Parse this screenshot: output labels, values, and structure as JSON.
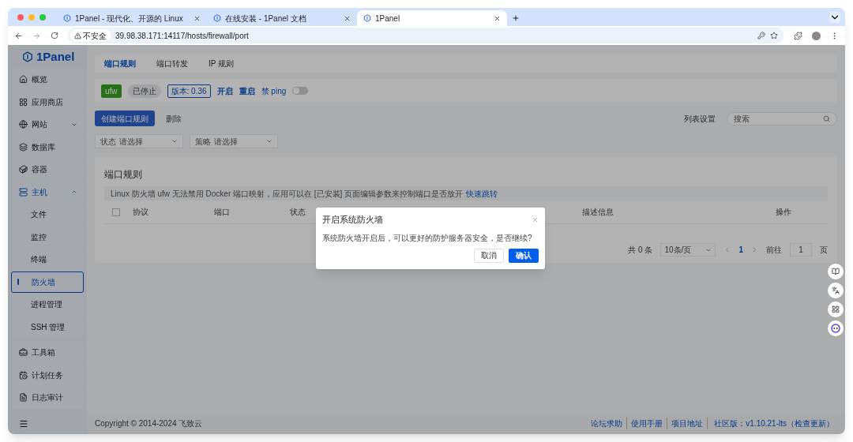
{
  "browser": {
    "tabs": [
      {
        "title": "1Panel - 现代化、开源的 Linux",
        "selected": false
      },
      {
        "title": "在线安装 - 1Panel 文档",
        "selected": false
      },
      {
        "title": "1Panel",
        "selected": true
      }
    ],
    "security": "不安全",
    "url": "39.98.38.171:14117/hosts/firewall/port"
  },
  "sidebar": {
    "logo": "1Panel",
    "items": [
      {
        "label": "概览",
        "selected": false
      },
      {
        "label": "应用商店",
        "selected": false
      },
      {
        "label": "网站",
        "expanded": false,
        "selected": false
      },
      {
        "label": "数据库",
        "selected": false
      },
      {
        "label": "容器",
        "selected": false
      },
      {
        "label": "主机",
        "expanded": true,
        "selected": true,
        "children": [
          {
            "label": "文件",
            "selected": false
          },
          {
            "label": "监控",
            "selected": false
          },
          {
            "label": "终端",
            "selected": false
          },
          {
            "label": "防火墙",
            "selected": true
          },
          {
            "label": "进程管理",
            "selected": false
          },
          {
            "label": "SSH 管理",
            "selected": false
          }
        ]
      },
      {
        "label": "工具箱",
        "selected": false
      },
      {
        "label": "计划任务",
        "selected": false
      },
      {
        "label": "日志审计",
        "selected": false
      }
    ]
  },
  "tabs": [
    {
      "label": "端口规则",
      "selected": true
    },
    {
      "label": "端口转发",
      "selected": false
    },
    {
      "label": "IP 规则",
      "selected": false
    }
  ],
  "status_bar": {
    "name": "ufw",
    "state": "已停止",
    "version": "版本: 0.36",
    "actions": [
      "开启",
      "重启"
    ],
    "ping_label": "禁 ping",
    "ping_toggle": {
      "on": false
    }
  },
  "toolbar": {
    "create": "创建端口规则",
    "delete": "删除",
    "list_settings": "列表设置",
    "search": {
      "placeholder": "搜索"
    }
  },
  "filters": [
    {
      "label": "状态",
      "placeholder": "请选择"
    },
    {
      "label": "策略",
      "placeholder": "请选择"
    }
  ],
  "section_title": "端口规则",
  "notice": {
    "text": "Linux 防火墙 ufw 无法禁用 Docker 端口映射，应用可以在 [已安装] 页面编辑参数来控制端口是否放开",
    "link": "快速跳转"
  },
  "table": {
    "select_all": {
      "checked": false
    },
    "columns": [
      {
        "label": "协议"
      },
      {
        "label": "端口"
      },
      {
        "label": "状态"
      },
      {
        "label": "描述信息"
      },
      {
        "label": "操作"
      }
    ]
  },
  "pagination": {
    "total": "共 0 条",
    "page_size": "10条/页",
    "current": "1",
    "goto": "前往",
    "goto_value": "1",
    "page_suffix": "页"
  },
  "footer": {
    "copyright": "Copyright © 2014-2024 飞致云",
    "links": [
      "论坛求助",
      "使用手册",
      "项目地址"
    ],
    "edition": "社区版：v1.10.21-lts（检查更新）"
  },
  "dialog": {
    "title": "开启系统防火墙",
    "message": "系统防火墙开启后，可以更好的防护服务器安全，是否继续?",
    "cancel": "取消",
    "confirm": "确认"
  }
}
